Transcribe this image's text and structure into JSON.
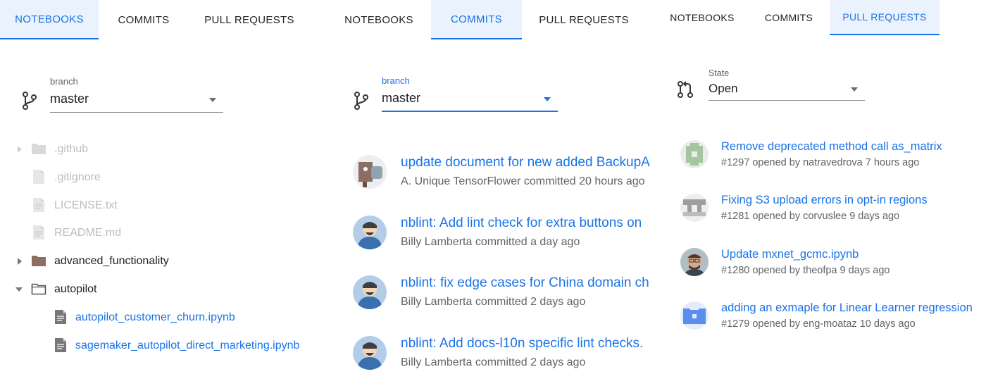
{
  "tabs": {
    "notebooks": "NOTEBOOKS",
    "commits": "COMMITS",
    "pull_requests": "PULL REQUESTS"
  },
  "notebooks_panel": {
    "active_tab": "notebooks",
    "branch_label": "branch",
    "branch_value": "master",
    "tree": [
      {
        "name": ".github",
        "kind": "folder",
        "state": "collapsed",
        "faded": true,
        "icon": "folder-icon"
      },
      {
        "name": ".gitignore",
        "kind": "file",
        "faded": true,
        "icon": "file-icon"
      },
      {
        "name": "LICENSE.txt",
        "kind": "file",
        "faded": true,
        "icon": "file-icon"
      },
      {
        "name": "README.md",
        "kind": "file",
        "faded": true,
        "icon": "file-icon"
      },
      {
        "name": "advanced_functionality",
        "kind": "folder",
        "state": "collapsed",
        "faded": false,
        "icon": "folder-icon"
      },
      {
        "name": "autopilot",
        "kind": "folder",
        "state": "expanded",
        "faded": false,
        "icon": "folder-open-icon"
      },
      {
        "name": "autopilot_customer_churn.ipynb",
        "kind": "notebook",
        "faded": false,
        "icon": "notebook-icon"
      },
      {
        "name": "sagemaker_autopilot_direct_marketing.ipynb",
        "kind": "notebook",
        "faded": false,
        "icon": "notebook-icon"
      }
    ]
  },
  "commits_panel": {
    "active_tab": "commits",
    "branch_label": "branch",
    "branch_value": "master",
    "commits": [
      {
        "title": "update document for new added BackupA",
        "meta": "A. Unique TensorFlower committed 20 hours ago",
        "avatar": "tensorflower-avatar"
      },
      {
        "title": "nblint: Add lint check for extra buttons on",
        "meta": "Billy Lamberta committed a day ago",
        "avatar": "user-avatar"
      },
      {
        "title": "nblint: fix edge cases for China domain ch",
        "meta": "Billy Lamberta committed 2 days ago",
        "avatar": "user-avatar"
      },
      {
        "title": "nblint: Add docs-l10n specific lint checks.",
        "meta": "Billy Lamberta committed 2 days ago",
        "avatar": "user-avatar"
      }
    ]
  },
  "prs_panel": {
    "active_tab": "pull_requests",
    "state_label": "State",
    "state_value": "Open",
    "prs": [
      {
        "title": "Remove deprecated method call as_matrix",
        "meta": "#1297 opened by natravedrova 7 hours ago",
        "avatar": "identicon-green"
      },
      {
        "title": "Fixing S3 upload errors in opt-in regions",
        "meta": "#1281 opened by corvuslee 9 days ago",
        "avatar": "identicon-gray"
      },
      {
        "title": "Update mxnet_gcmc.ipynb",
        "meta": "#1280 opened by theofpa 9 days ago",
        "avatar": "photo-avatar"
      },
      {
        "title": "adding an exmaple for Linear Learner regression",
        "meta": "#1279 opened by eng-moataz 10 days ago",
        "avatar": "identicon-blue"
      }
    ]
  },
  "colors": {
    "accent": "#1a73e8",
    "active_tab_bg": "#eaf2fd",
    "faded_text": "#bdbdbd",
    "meta_text": "#5f6368"
  }
}
